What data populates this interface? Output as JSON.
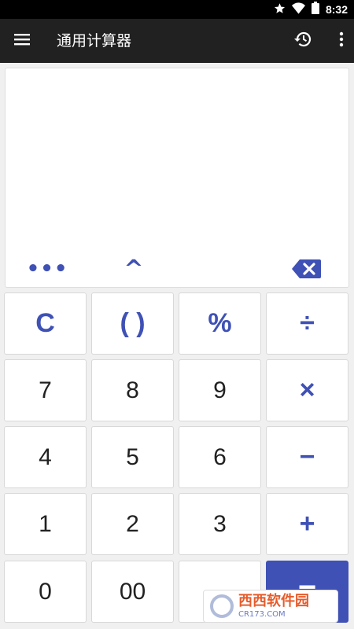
{
  "status_bar": {
    "time": "8:32",
    "icons": [
      "star-icon",
      "wifi-icon",
      "battery-icon"
    ]
  },
  "toolbar": {
    "title": "通用计算器",
    "menu_icon": "hamburger-menu-icon",
    "history_icon": "history-icon",
    "more_icon": "more-vertical-icon"
  },
  "display": {
    "expression": "",
    "result": ""
  },
  "aux_buttons": {
    "ellipsis": "•••",
    "power": "^",
    "backspace_icon": "backspace-icon"
  },
  "keypad": {
    "clear": "C",
    "parentheses": "( )",
    "percent": "%",
    "divide": "÷",
    "seven": "7",
    "eight": "8",
    "nine": "9",
    "multiply": "×",
    "four": "4",
    "five": "5",
    "six": "6",
    "minus": "−",
    "one": "1",
    "two": "2",
    "three": "3",
    "plus": "+",
    "zero": "0",
    "double_zero": "00",
    "decimal": "",
    "equals": "="
  },
  "watermark": {
    "main": "西西软件园",
    "sub": "CR173.COM"
  },
  "colors": {
    "accent": "#3f51b5",
    "toolbar": "#212121",
    "background": "#f0f0f0"
  }
}
